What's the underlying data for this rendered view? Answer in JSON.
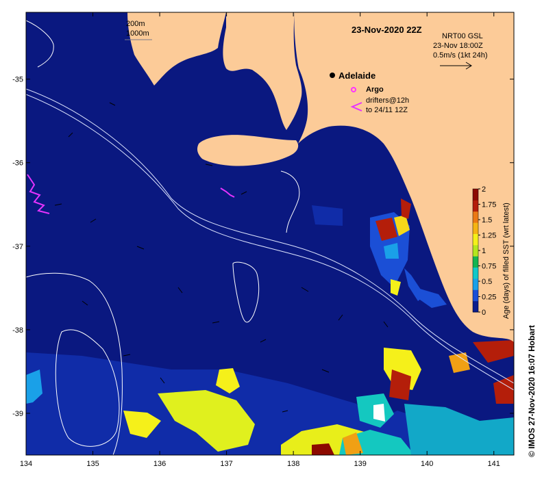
{
  "title": "23-Nov-2020 22Z",
  "place_label": "Adelaide",
  "bathymetry_legend": {
    "line1": "200m",
    "line2": "1000m"
  },
  "velocity_legend": {
    "line1": "NRT00 GSL",
    "line2": "23-Nov 18:00Z",
    "line3": "0.5m/s (1kt 24h)"
  },
  "argo_label": "Argo",
  "drifters_label": {
    "line1": "drifters@12h",
    "line2": "to 24/11 12Z"
  },
  "credit": "© IMOS 27-Nov-2020 16:07 Hobart",
  "colors": {
    "ocean": "#0a1880",
    "land": "#fccb98",
    "contour": "#dfe6ff",
    "argo": "#ff33ff",
    "drifter": "#e633ff"
  },
  "chart_data": {
    "type": "heatmap",
    "x_axis": {
      "range": [
        134,
        141.3
      ],
      "ticks": [
        "134",
        "135",
        "136",
        "137",
        "138",
        "139",
        "140",
        "141"
      ]
    },
    "y_axis": {
      "range": [
        -39.5,
        -34.2
      ],
      "ticks": [
        "-35",
        "-36",
        "-37",
        "-38",
        "-39"
      ]
    },
    "colorbar": {
      "label": "Age (days) of filled SST (wrt latest)",
      "range": [
        0,
        2
      ],
      "ticks": [
        "2",
        "1.75",
        "1.5",
        "1.25",
        "1",
        "0.75",
        "0.5",
        "0.25",
        "0"
      ],
      "colors": [
        "#0b1d8c",
        "#1b4fd6",
        "#1aa0e8",
        "#12c8c8",
        "#14b450",
        "#b4e61e",
        "#f5f01a",
        "#f5b414",
        "#eb7814",
        "#b41e0a",
        "#8c0a00"
      ]
    }
  }
}
